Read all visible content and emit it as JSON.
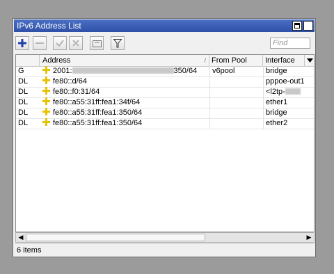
{
  "window": {
    "title": "IPv6 Address List"
  },
  "toolbar": {
    "buttons": [
      {
        "name": "add",
        "icon": "plus-icon"
      },
      {
        "name": "remove",
        "icon": "minus-icon"
      },
      {
        "name": "enable",
        "icon": "check-icon"
      },
      {
        "name": "disable",
        "icon": "x-icon"
      },
      {
        "name": "comment",
        "icon": "note-icon"
      },
      {
        "name": "filter",
        "icon": "filter-icon"
      }
    ],
    "find_placeholder": "Find"
  },
  "table": {
    "columns": [
      "",
      "Address",
      "From Pool",
      "Interface"
    ],
    "rows": [
      {
        "flags": "G",
        "address_prefix": "2001:",
        "address_suffix": "350/64",
        "from_pool": "v6pool",
        "interface": "bridge"
      },
      {
        "flags": "DL",
        "address_prefix": "fe80::d/64",
        "address_suffix": "",
        "from_pool": "",
        "interface": "pppoe-out1"
      },
      {
        "flags": "DL",
        "address_prefix": "fe80::f0:31/64",
        "address_suffix": "",
        "from_pool": "",
        "interface": "<l2tp-"
      },
      {
        "flags": "DL",
        "address_prefix": "fe80::a55:31ff:fea1:34f/64",
        "address_suffix": "",
        "from_pool": "",
        "interface": "ether1"
      },
      {
        "flags": "DL",
        "address_prefix": "fe80::a55:31ff:fea1:350/64",
        "address_suffix": "",
        "from_pool": "",
        "interface": "bridge"
      },
      {
        "flags": "DL",
        "address_prefix": "fe80::a55:31ff:fea1:350/64",
        "address_suffix": "",
        "from_pool": "",
        "interface": "ether2"
      }
    ]
  },
  "status": {
    "items": "6 items"
  },
  "colors": {
    "titlebar": "#2f50a8",
    "address_icon": "#e6c200",
    "add_icon": "#1f3fa8"
  }
}
